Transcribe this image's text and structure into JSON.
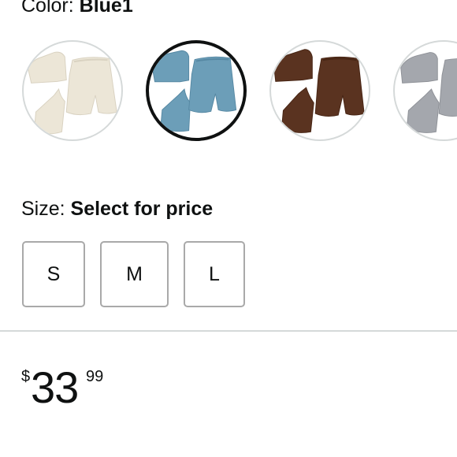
{
  "color": {
    "label": "Color: ",
    "selected": "Blue1",
    "swatches": [
      {
        "name": "Cream",
        "fill": "#ece6d7",
        "shade": "#d9d2c1",
        "selected": false
      },
      {
        "name": "Blue1",
        "fill": "#6c9eb8",
        "shade": "#5688a3",
        "selected": true
      },
      {
        "name": "Brown",
        "fill": "#5a3320",
        "shade": "#472514",
        "selected": false
      },
      {
        "name": "Gray",
        "fill": "#a4a7ad",
        "shade": "#8e9197",
        "selected": false
      }
    ]
  },
  "size": {
    "label": "Size: ",
    "value": "Select for price",
    "options": [
      "S",
      "M",
      "L"
    ]
  },
  "price": {
    "symbol": "$",
    "whole": "33",
    "fraction": "99"
  }
}
